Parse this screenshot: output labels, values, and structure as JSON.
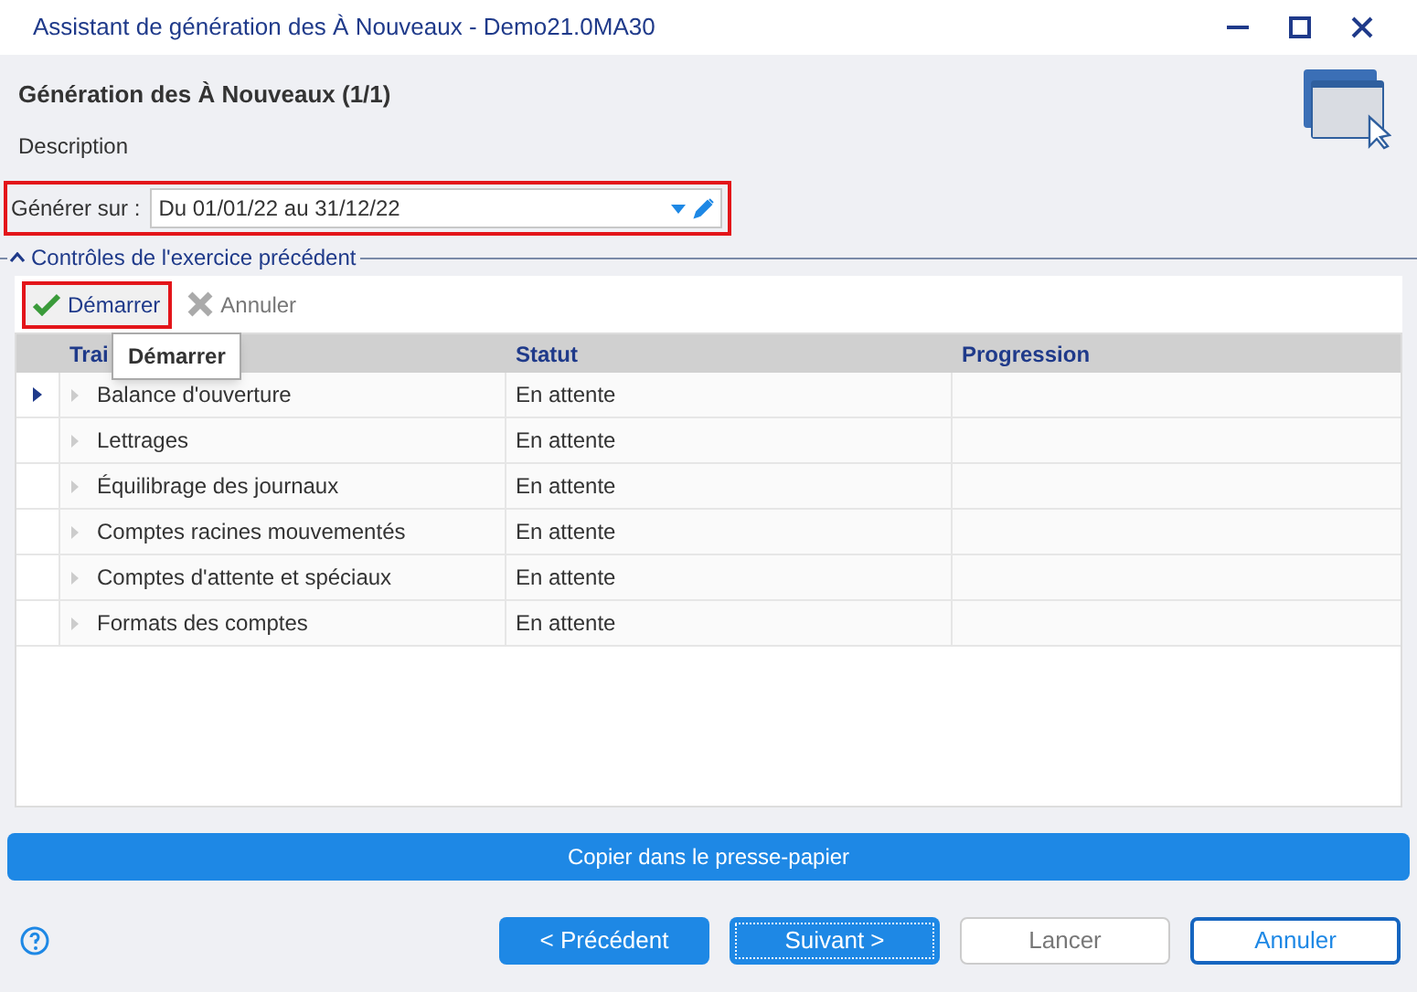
{
  "window": {
    "title": "Assistant de génération des À Nouveaux - Demo21.0MA30"
  },
  "header": {
    "title": "Génération des À Nouveaux (1/1)",
    "subtitle": "Description"
  },
  "period": {
    "label": "Générer sur :",
    "value": "Du 01/01/22 au 31/12/22",
    "highlighted": true
  },
  "group": {
    "title": "Contrôles de l'exercice précédent",
    "expanded": true
  },
  "toolbar": [
    {
      "kind": "start",
      "label": "Démarrer",
      "highlighted": true,
      "disabled": false
    },
    {
      "kind": "cancel",
      "label": "Annuler",
      "highlighted": false,
      "disabled": true
    }
  ],
  "tooltip": {
    "text": "Démarrer"
  },
  "table": {
    "columns": [
      "Trai",
      "Statut",
      "Progression"
    ],
    "rows": [
      {
        "name": "Balance d'ouverture",
        "status": "En attente",
        "selected": true
      },
      {
        "name": "Lettrages",
        "status": "En attente",
        "selected": false
      },
      {
        "name": "Équilibrage des journaux",
        "status": "En attente",
        "selected": false
      },
      {
        "name": "Comptes racines mouvementés",
        "status": "En attente",
        "selected": false
      },
      {
        "name": "Comptes d'attente et spéciaux",
        "status": "En attente",
        "selected": false
      },
      {
        "name": "Formats des comptes",
        "status": "En attente",
        "selected": false
      }
    ]
  },
  "copy_button": {
    "label": "Copier dans le presse-papier"
  },
  "buttons": [
    {
      "label": "< Précédent",
      "kind": "primary",
      "focused": false
    },
    {
      "label": "Suivant >",
      "kind": "primary",
      "focused": true
    },
    {
      "label": "Lancer",
      "kind": "disabled",
      "focused": false
    },
    {
      "label": "Annuler",
      "kind": "outline",
      "focused": false
    }
  ]
}
